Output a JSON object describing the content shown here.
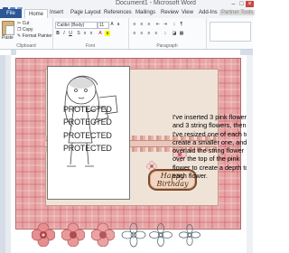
{
  "window": {
    "title": "Document1 - Microsoft Word"
  },
  "tabs": [
    "File",
    "Home",
    "Insert",
    "Page Layout",
    "References",
    "Mailings",
    "Review",
    "View",
    "Add-Ins",
    "Partner Tools"
  ],
  "ribbon": {
    "clipboard": {
      "paste": "Paste",
      "cut": "Cut",
      "copy": "Copy",
      "format_painter": "Format Painter",
      "label": "Clipboard"
    },
    "font": {
      "name": "Calibri (Body)",
      "size": "11",
      "label": "Font"
    },
    "paragraph": {
      "label": "Paragraph"
    }
  },
  "document": {
    "protected_marks": [
      "PROTECTED",
      "PROTECTED",
      "PROTECTED",
      "PROTECTED"
    ],
    "label_text": "Happy Birthday",
    "description": "I've inserted 3 pink flowers, and 3 string flowers, then I've resized one of each to create a smaller one, and overlaid the string flower over the top of the pink flower to create a depth to each flower."
  },
  "icons": {
    "paste": "paste-icon",
    "cut": "scissors-icon",
    "copy": "copy-icon",
    "format_painter": "brush-icon"
  },
  "colors": {
    "file_tab": "#2b5797",
    "card_pink": "#e8a5a5",
    "flower_pink": "#d9747e"
  }
}
